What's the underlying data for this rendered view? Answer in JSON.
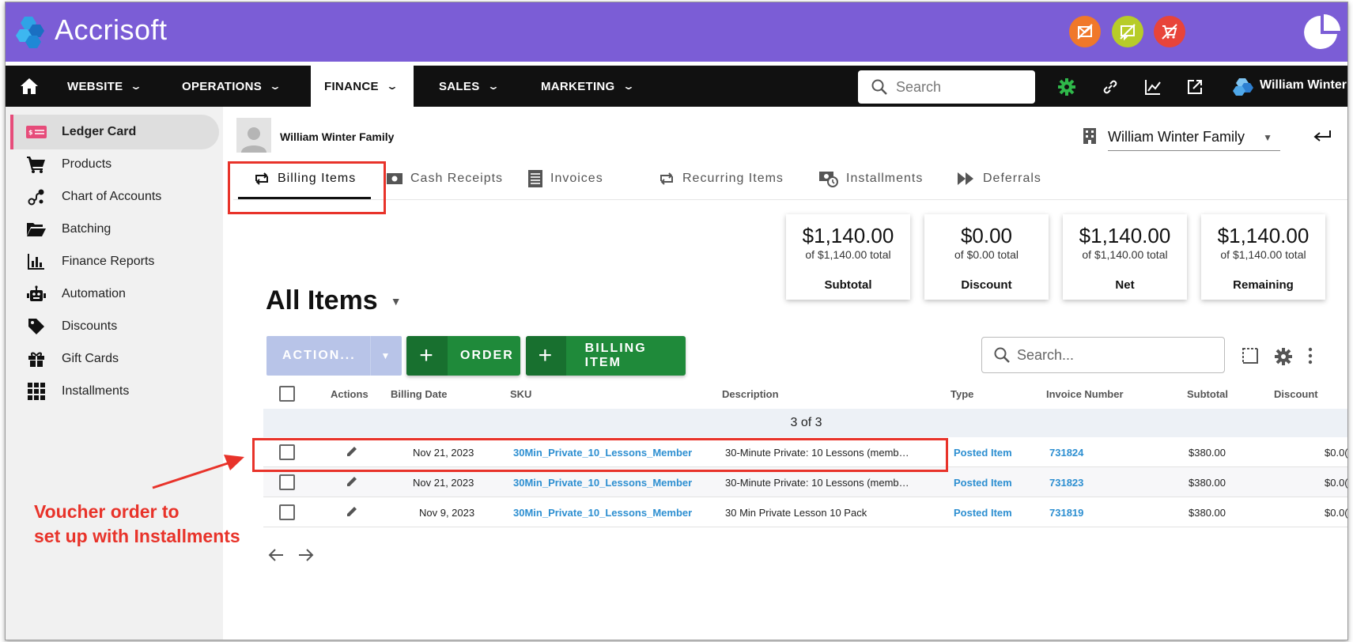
{
  "app": {
    "logo_text": "Accrisoft",
    "brand_color": "#7b5dd6",
    "top_icons": [
      {
        "name": "mail-off-icon",
        "color": "#f0782a"
      },
      {
        "name": "message-off-icon",
        "color": "#b7cc29"
      },
      {
        "name": "cart-off-icon",
        "color": "#e8443a"
      },
      {
        "name": "pie-chart-icon",
        "color": "#ffffff"
      }
    ]
  },
  "nav": {
    "items": [
      {
        "label": "WEBSITE"
      },
      {
        "label": "OPERATIONS"
      },
      {
        "label": "FINANCE"
      },
      {
        "label": "SALES"
      },
      {
        "label": "MARKETING"
      }
    ],
    "active": "FINANCE",
    "search_placeholder": "Search",
    "user_name": "William Winter"
  },
  "sidebar": {
    "items": [
      {
        "label": "Ledger Card",
        "icon": "ledger-card-icon"
      },
      {
        "label": "Products",
        "icon": "cart-icon"
      },
      {
        "label": "Chart of Accounts",
        "icon": "chart-accounts-icon"
      },
      {
        "label": "Batching",
        "icon": "folder-open-icon"
      },
      {
        "label": "Finance Reports",
        "icon": "bar-chart-icon"
      },
      {
        "label": "Automation",
        "icon": "robot-icon"
      },
      {
        "label": "Discounts",
        "icon": "tag-icon"
      },
      {
        "label": "Gift Cards",
        "icon": "gift-icon"
      },
      {
        "label": "Installments",
        "icon": "grid-icon"
      }
    ],
    "active": "Ledger Card"
  },
  "header": {
    "family_name": "William Winter Family",
    "selected_account": "William Winter Family"
  },
  "tabs": [
    {
      "label": "Billing Items"
    },
    {
      "label": "Cash Receipts"
    },
    {
      "label": "Invoices"
    },
    {
      "label": "Recurring Items"
    },
    {
      "label": "Installments"
    },
    {
      "label": "Deferrals"
    }
  ],
  "actions_label": "ACTIONS",
  "summary_cards": [
    {
      "amount": "$1,140.00",
      "sub": "of $1,140.00 total",
      "label": "Subtotal"
    },
    {
      "amount": "$0.00",
      "sub": "of $0.00 total",
      "label": "Discount"
    },
    {
      "amount": "$1,140.00",
      "sub": "of $1,140.00 total",
      "label": "Net"
    },
    {
      "amount": "$1,140.00",
      "sub": "of $1,140.00 total",
      "label": "Remaining"
    }
  ],
  "list": {
    "title": "All Items",
    "action_button": "ACTION...",
    "order_button": "ORDER",
    "billing_item_button": "BILLING ITEM",
    "search_placeholder": "Search...",
    "columns": [
      "Actions",
      "Billing Date",
      "SKU",
      "Description",
      "Type",
      "Invoice Number",
      "Subtotal",
      "Discount"
    ],
    "group_label": "3 of 3",
    "rows": [
      {
        "date": "Nov 21, 2023",
        "sku": "30Min_Private_10_Lessons_Member",
        "description": "30-Minute Private: 10 Lessons (memb…",
        "type": "Posted Item",
        "invoice": "731824",
        "subtotal": "$380.00",
        "discount": "$0.0("
      },
      {
        "date": "Nov 21, 2023",
        "sku": "30Min_Private_10_Lessons_Member",
        "description": "30-Minute Private: 10 Lessons (memb…",
        "type": "Posted Item",
        "invoice": "731823",
        "subtotal": "$380.00",
        "discount": "$0.0("
      },
      {
        "date": "Nov 9, 2023",
        "sku": "30Min_Private_10_Lessons_Member",
        "description": "30 Min Private Lesson 10 Pack",
        "type": "Posted Item",
        "invoice": "731819",
        "subtotal": "$380.00",
        "discount": "$0.0("
      }
    ]
  },
  "annotation": {
    "line1": "Voucher order to",
    "line2": "set up with Installments",
    "color": "#e8332a"
  }
}
